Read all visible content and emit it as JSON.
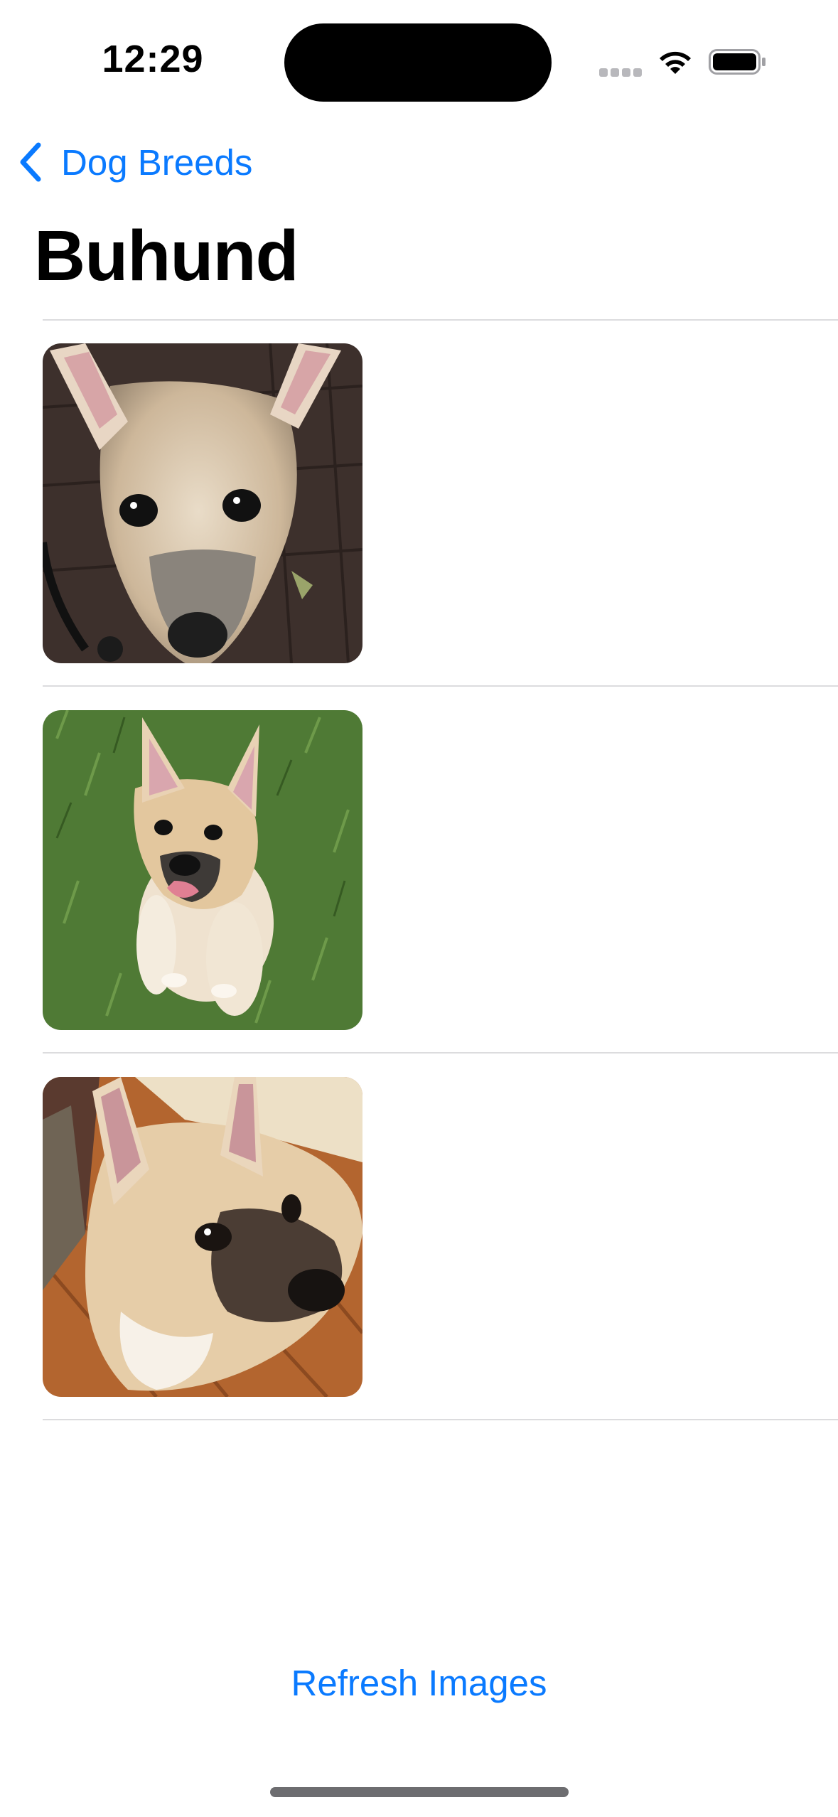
{
  "status_bar": {
    "time": "12:29",
    "wifi_icon": "wifi-icon",
    "battery_icon": "battery-icon",
    "signal_icon": "cellular-signal-icon"
  },
  "nav": {
    "back_label": "Dog Breeds",
    "back_icon": "chevron-left-icon",
    "title": "Buhund"
  },
  "images": [
    {
      "alt": "dog-photo",
      "subject": "close-up of puppy face on brick patio"
    },
    {
      "alt": "dog-photo",
      "subject": "puppy sitting in grass"
    },
    {
      "alt": "dog-photo",
      "subject": "puppy lying on wood floor"
    }
  ],
  "actions": {
    "refresh_label": "Refresh Images"
  },
  "colors": {
    "accent": "#0a7aff",
    "divider": "#dcdcde",
    "home_indicator": "#6d6d70"
  }
}
